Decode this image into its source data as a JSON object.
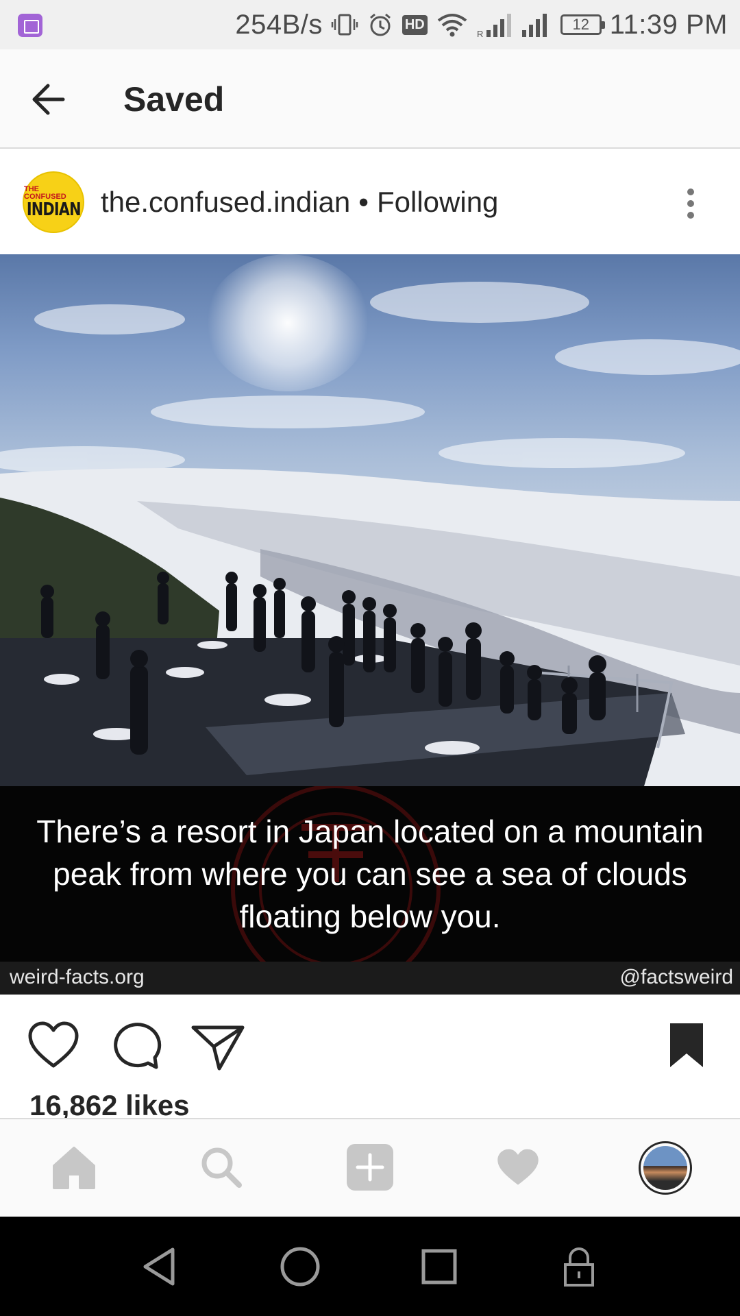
{
  "status_bar": {
    "network_speed": "254B/s",
    "hd_badge": "HD",
    "battery_level": "12",
    "time": "11:39 PM"
  },
  "header": {
    "title": "Saved"
  },
  "post": {
    "username": "the.confused.indian",
    "separator": "•",
    "follow_status": "Following",
    "avatar_logo": {
      "small_text": "THE CONFUSED",
      "big_text": "INDIAN"
    },
    "image_caption": "There’s a resort in Japan located on a mountain peak from where you can see a sea of clouds floating below you.",
    "image_source_left": "weird-facts.org",
    "image_source_right": "@factsweird",
    "likes": "16,862 likes",
    "saved": true
  },
  "icons": {
    "back": "arrow-left-icon",
    "more": "vertical-dots-icon",
    "like": "heart-outline-icon",
    "comment": "speech-bubble-icon",
    "share": "paper-plane-icon",
    "save": "bookmark-filled-icon",
    "home": "home-icon",
    "search": "search-icon",
    "add": "plus-square-icon",
    "activity": "heart-filled-icon"
  },
  "colors": {
    "text": "#262626",
    "nav_inactive": "#c7c7c7",
    "brand_logo_yellow": "#f7d117",
    "caption_bg": "#050505"
  }
}
